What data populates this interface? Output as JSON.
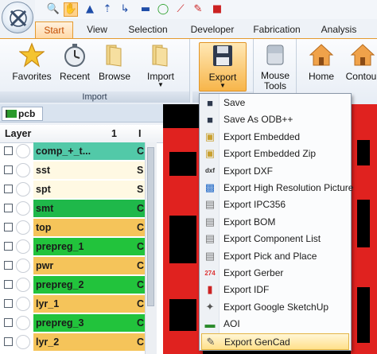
{
  "quickbar": {
    "icons": [
      "search-icon",
      "hand-icon",
      "select-arrow-icon",
      "move-arrow-icon",
      "route-icon",
      "line-icon",
      "circle-icon",
      "brush-icon",
      "pen-icon",
      "fill-icon"
    ]
  },
  "tabs": [
    "Start",
    "View",
    "Selection",
    "Developer",
    "Fabrication",
    "Analysis"
  ],
  "ribbon": {
    "favorites": "Favorites",
    "recent": "Recent",
    "browse": "Browse",
    "import": "Import",
    "import_group": "Import",
    "export": "Export",
    "mouse_tools": "Mouse Tools",
    "home": "Home",
    "contour": "Contour"
  },
  "pcb_tab": "pcb",
  "layer_table": {
    "headers": {
      "layer": "Layer",
      "col1": "1",
      "col2": "I"
    },
    "rows": [
      {
        "name": "comp_+_t...",
        "col2": "C",
        "color": "#52c9a8"
      },
      {
        "name": "sst",
        "col2": "S",
        "color": "#fff9e3"
      },
      {
        "name": "spt",
        "col2": "S",
        "color": "#fff9e3"
      },
      {
        "name": "smt",
        "col2": "C",
        "color": "#1fb84a"
      },
      {
        "name": "top",
        "col2": "C",
        "color": "#f5c45a"
      },
      {
        "name": "prepreg_1",
        "col2": "C",
        "color": "#22c33c"
      },
      {
        "name": "pwr",
        "col2": "C",
        "color": "#f5c45a"
      },
      {
        "name": "prepreg_2",
        "col2": "C",
        "color": "#22c33c"
      },
      {
        "name": "lyr_1",
        "col2": "C",
        "color": "#f5c45a"
      },
      {
        "name": "prepreg_3",
        "col2": "C",
        "color": "#22c33c"
      },
      {
        "name": "lyr_2",
        "col2": "C",
        "color": "#f5c45a"
      }
    ]
  },
  "export_menu": [
    {
      "label": "Save",
      "icon": "save-icon"
    },
    {
      "label": "Save As ODB++",
      "icon": "save-as-icon"
    },
    {
      "label": "Export Embedded",
      "icon": "embedded-icon"
    },
    {
      "label": "Export Embedded Zip",
      "icon": "zip-icon"
    },
    {
      "label": "Export DXF",
      "icon": "dxf-icon"
    },
    {
      "label": "Export High Resolution Picture",
      "icon": "picture-icon"
    },
    {
      "label": "Export IPC356",
      "icon": "document-icon"
    },
    {
      "label": "Export BOM",
      "icon": "document-icon"
    },
    {
      "label": "Export Component List",
      "icon": "document-icon"
    },
    {
      "label": "Export Pick and Place",
      "icon": "document-icon"
    },
    {
      "label": "Export Gerber",
      "icon": "gerber-icon"
    },
    {
      "label": "Export IDF",
      "icon": "idf-icon"
    },
    {
      "label": "Export Google SketchUp",
      "icon": "sketchup-icon"
    },
    {
      "label": "AOI",
      "icon": "aoi-icon"
    },
    {
      "label": "Export GenCad",
      "icon": "gencad-icon"
    }
  ],
  "colors": {
    "accent": "#e59a2e",
    "canvas_red": "#e0221f",
    "canvas_bg": "#000000"
  }
}
